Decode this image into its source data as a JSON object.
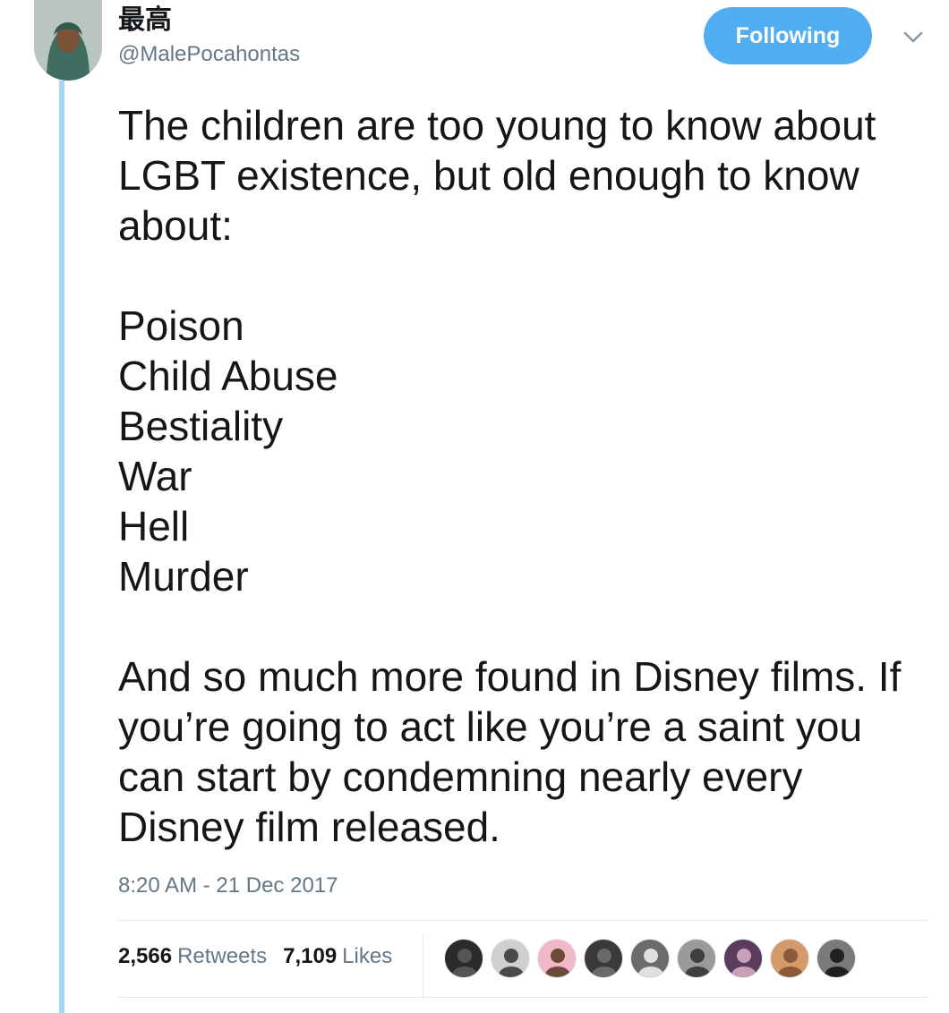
{
  "user": {
    "display_name": "最高",
    "handle": "@MalePocahontas"
  },
  "follow_button": {
    "label": "Following"
  },
  "tweet": {
    "intro": "The children are too young to know about LGBT existence, but old enough to know about:",
    "list": [
      "Poison",
      "Child Abuse",
      "Bestiality",
      "War",
      "Hell",
      "Murder"
    ],
    "closing": "And so much more found in Disney films. If you’re going to act like you’re a saint you can start by condemning nearly every Disney film released."
  },
  "timestamp": "8:20 AM - 21 Dec 2017",
  "stats": {
    "retweets_count": "2,566",
    "retweets_label": "Retweets",
    "likes_count": "7,109",
    "likes_label": "Likes"
  },
  "colors": {
    "accent": "#52aef2",
    "thread_line": "#a7d6f5",
    "secondary_text": "#657786"
  },
  "icons": {
    "caret": "chevron-down-icon"
  },
  "liker_avatars": [
    {
      "tone": "#2b2b2b",
      "accent": "#555555"
    },
    {
      "tone": "#cfcfcf",
      "accent": "#4a4a4a"
    },
    {
      "tone": "#f1b8c8",
      "accent": "#6b4a3a"
    },
    {
      "tone": "#3a3a3a",
      "accent": "#6a6a6a"
    },
    {
      "tone": "#6b6b6b",
      "accent": "#e0e0e0"
    },
    {
      "tone": "#9a9a9a",
      "accent": "#3e3e3e"
    },
    {
      "tone": "#5a3d5c",
      "accent": "#c9a0b8"
    },
    {
      "tone": "#d69a6a",
      "accent": "#8a5a3a"
    },
    {
      "tone": "#7a7a7a",
      "accent": "#202020"
    }
  ]
}
